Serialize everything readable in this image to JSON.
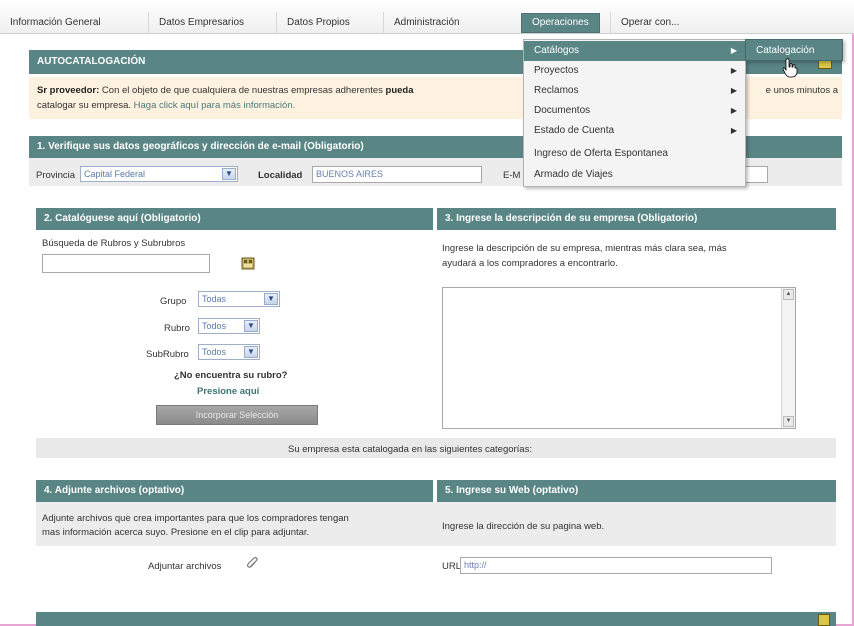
{
  "nav": {
    "tabs": [
      {
        "label": "Información General"
      },
      {
        "label": "Datos Empresarios"
      },
      {
        "label": "Datos Propios"
      },
      {
        "label": "Administración"
      },
      {
        "label": "Operaciones"
      },
      {
        "label": "Operar con..."
      }
    ]
  },
  "menu": {
    "items": [
      {
        "label": "Catálogos",
        "has_sub": true
      },
      {
        "label": "Proyectos",
        "has_sub": true
      },
      {
        "label": "Reclamos",
        "has_sub": true
      },
      {
        "label": "Documentos",
        "has_sub": true
      },
      {
        "label": "Estado de Cuenta",
        "has_sub": true
      },
      {
        "label": "Ingreso de Oferta Espontanea",
        "has_sub": false
      },
      {
        "label": "Armado de Viajes",
        "has_sub": false
      }
    ],
    "submenu_item": "Catalogación"
  },
  "autocatalogacion": {
    "title": "AUTOCATALOGACIÓN",
    "note_bold": "Sr proveedor:",
    "note_text": " Con el objeto de que cualquiera de nuestras empresas adherentes ",
    "note_bold2": "pueda",
    "note_right": "e unos minutos a",
    "note_line2": "catalogar su empresa. ",
    "note_link": "Haga click aquí para más información."
  },
  "section1": {
    "title": "1. Verifique sus datos geográficos y dirección de e-mail (Obligatorio)",
    "provincia_label": "Provincia",
    "provincia_value": "Capital Federal",
    "localidad_label": "Localidad",
    "localidad_value": "BUENOS AIRES",
    "email_label": "E-M"
  },
  "section2": {
    "title": "2. Catalóguese aquí (Obligatorio)",
    "search_label": "Búsqueda de Rubros y Subrubros",
    "grupo_label": "Grupo",
    "grupo_value": "Todas",
    "rubro_label": "Rubro",
    "rubro_value": "Todos",
    "subrubro_label": "SubRubro",
    "subrubro_value": "Todos",
    "no_encuentra": "¿No encuentra su rubro?",
    "presione": "Presione aquí",
    "incorporar_button": "Incorporar Selección"
  },
  "section3": {
    "title": "3. Ingrese la descripción de su empresa (Obligatorio)",
    "description": "Ingrese la descripción de su empresa, mientras más clara sea, más",
    "description2": "ayudará a los compradores a encontrarlo."
  },
  "catalogada_text": "Su empresa esta catalogada en las siguientes categorías:",
  "section4": {
    "title": "4. Adjunte archivos (optativo)",
    "text1": "Adjunte archivos que crea importantes para que los compradores tengan",
    "text2": "mas información acerca suyo. Presione en el clip para adjuntar.",
    "adjuntar_label": "Adjuntar archivos"
  },
  "section5": {
    "title": "5. Ingrese su Web (optativo)",
    "text": "Ingrese la dirección de su pagina web.",
    "url_label": "URL",
    "url_value": "http://"
  },
  "colors": {
    "header_teal": "#5a8585",
    "note_bg": "#fdf1df",
    "frame_pink": "#e6a6d4"
  }
}
